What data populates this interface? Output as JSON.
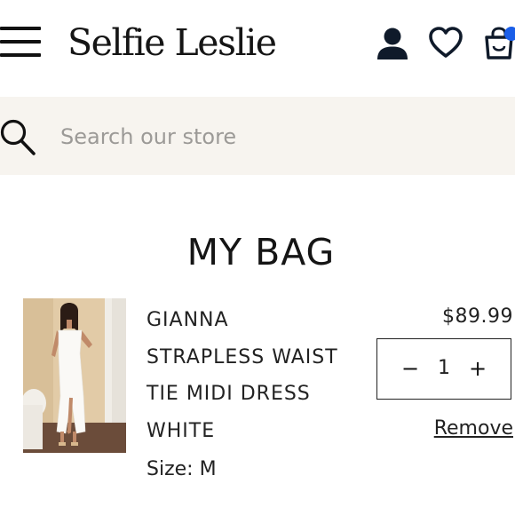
{
  "header": {
    "logo_text": "Selfie Leslie",
    "menu_icon": "hamburger-menu-icon",
    "account_icon": "account-icon",
    "wishlist_icon": "heart-icon",
    "cart_icon": "shopping-bag-icon",
    "cart_badge_color": "#1a5ee8"
  },
  "search": {
    "placeholder": "Search our store",
    "value": "",
    "icon": "search-icon",
    "background": "#f7f4ef"
  },
  "page": {
    "title": "MY BAG"
  },
  "cart": {
    "items": [
      {
        "name_lines": [
          "GIANNA",
          "STRAPLESS WAIST",
          "TIE MIDI DRESS",
          "WHITE"
        ],
        "size_label": "Size: M",
        "price": "$89.99",
        "quantity": "1",
        "decrease_symbol": "−",
        "increase_symbol": "+",
        "remove_label": "Remove",
        "image": "product-photo"
      }
    ]
  }
}
